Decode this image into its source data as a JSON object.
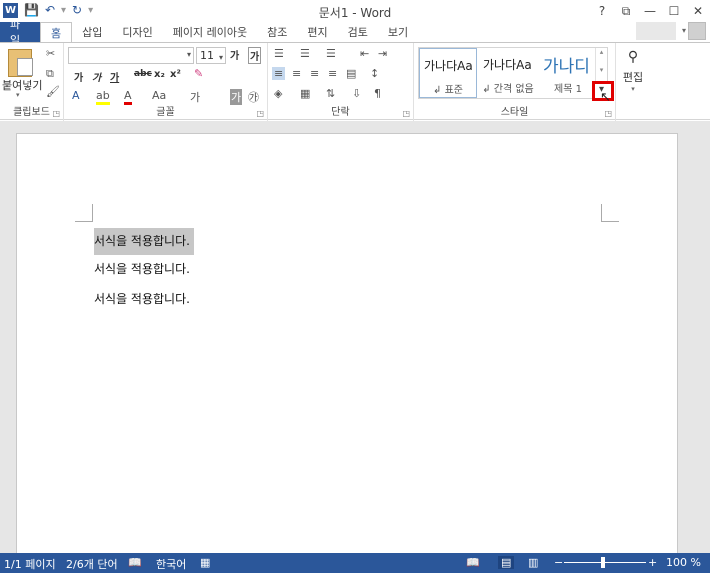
{
  "app": {
    "title": "문서1 - Word",
    "logo_letter": "W",
    "window_controls": [
      "?",
      "⧉",
      "—",
      "☐",
      "✕"
    ]
  },
  "tabs": [
    {
      "label": "파일"
    },
    {
      "label": "홈"
    },
    {
      "label": "삽입"
    },
    {
      "label": "디자인"
    },
    {
      "label": "페이지 레이아웃"
    },
    {
      "label": "참조"
    },
    {
      "label": "편지"
    },
    {
      "label": "검토"
    },
    {
      "label": "보기"
    }
  ],
  "ribbon": {
    "clipboard": {
      "paste_label": "붙여넣기",
      "group_label": "클립보드"
    },
    "font": {
      "font_name": "",
      "font_size": "11",
      "grow_font": "가",
      "shrink_font": "가",
      "buttons": [
        "가",
        "가",
        "가",
        "abc",
        "x₂",
        "x²"
      ],
      "group_label": "글꼴",
      "change_case": "Aa"
    },
    "paragraph": {
      "group_label": "단락"
    },
    "styles": {
      "items": [
        {
          "preview": "가나다Aa",
          "name": "↲ 표준"
        },
        {
          "preview": "가나다Aa",
          "name": "↲ 간격 없음"
        },
        {
          "preview": "가나디",
          "name": "제목 1"
        }
      ],
      "group_label": "스타일"
    },
    "editing": {
      "label": "편집"
    }
  },
  "document": {
    "paragraphs": [
      "서식을 적용합니다.",
      "서식을 적용합니다.",
      "서식을 적용합니다."
    ]
  },
  "statusbar": {
    "page": "1/1 페이지",
    "words": "2/6개 단어",
    "language": "한국어",
    "zoom": "100 %"
  },
  "colors": {
    "accent": "#2b579a",
    "highlight_box": "#e00000",
    "selection": "#c7c7c7"
  }
}
